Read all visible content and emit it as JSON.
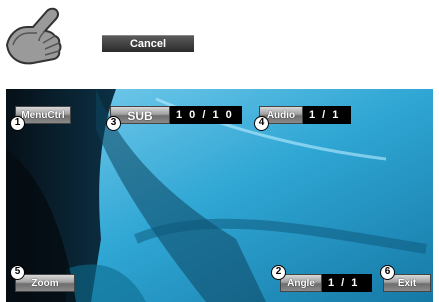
{
  "top": {
    "cancel_label": "Cancel",
    "pointer_icon": "pointing-hand-icon"
  },
  "buttons": {
    "menuctrl": "MenuCtrl",
    "sub": "SUB",
    "sub_value": "1 0 / 1 0",
    "audio": "Audio",
    "audio_value": "1 / 1",
    "zoom": "Zoom",
    "angle": "Angle",
    "angle_value": "1 / 1",
    "exit": "Exit"
  },
  "markers": [
    "1",
    "2",
    "3",
    "4",
    "5",
    "6"
  ],
  "colors": {
    "screen_blue": "#3ab0d8",
    "button_grey": "#a0a0a0"
  }
}
